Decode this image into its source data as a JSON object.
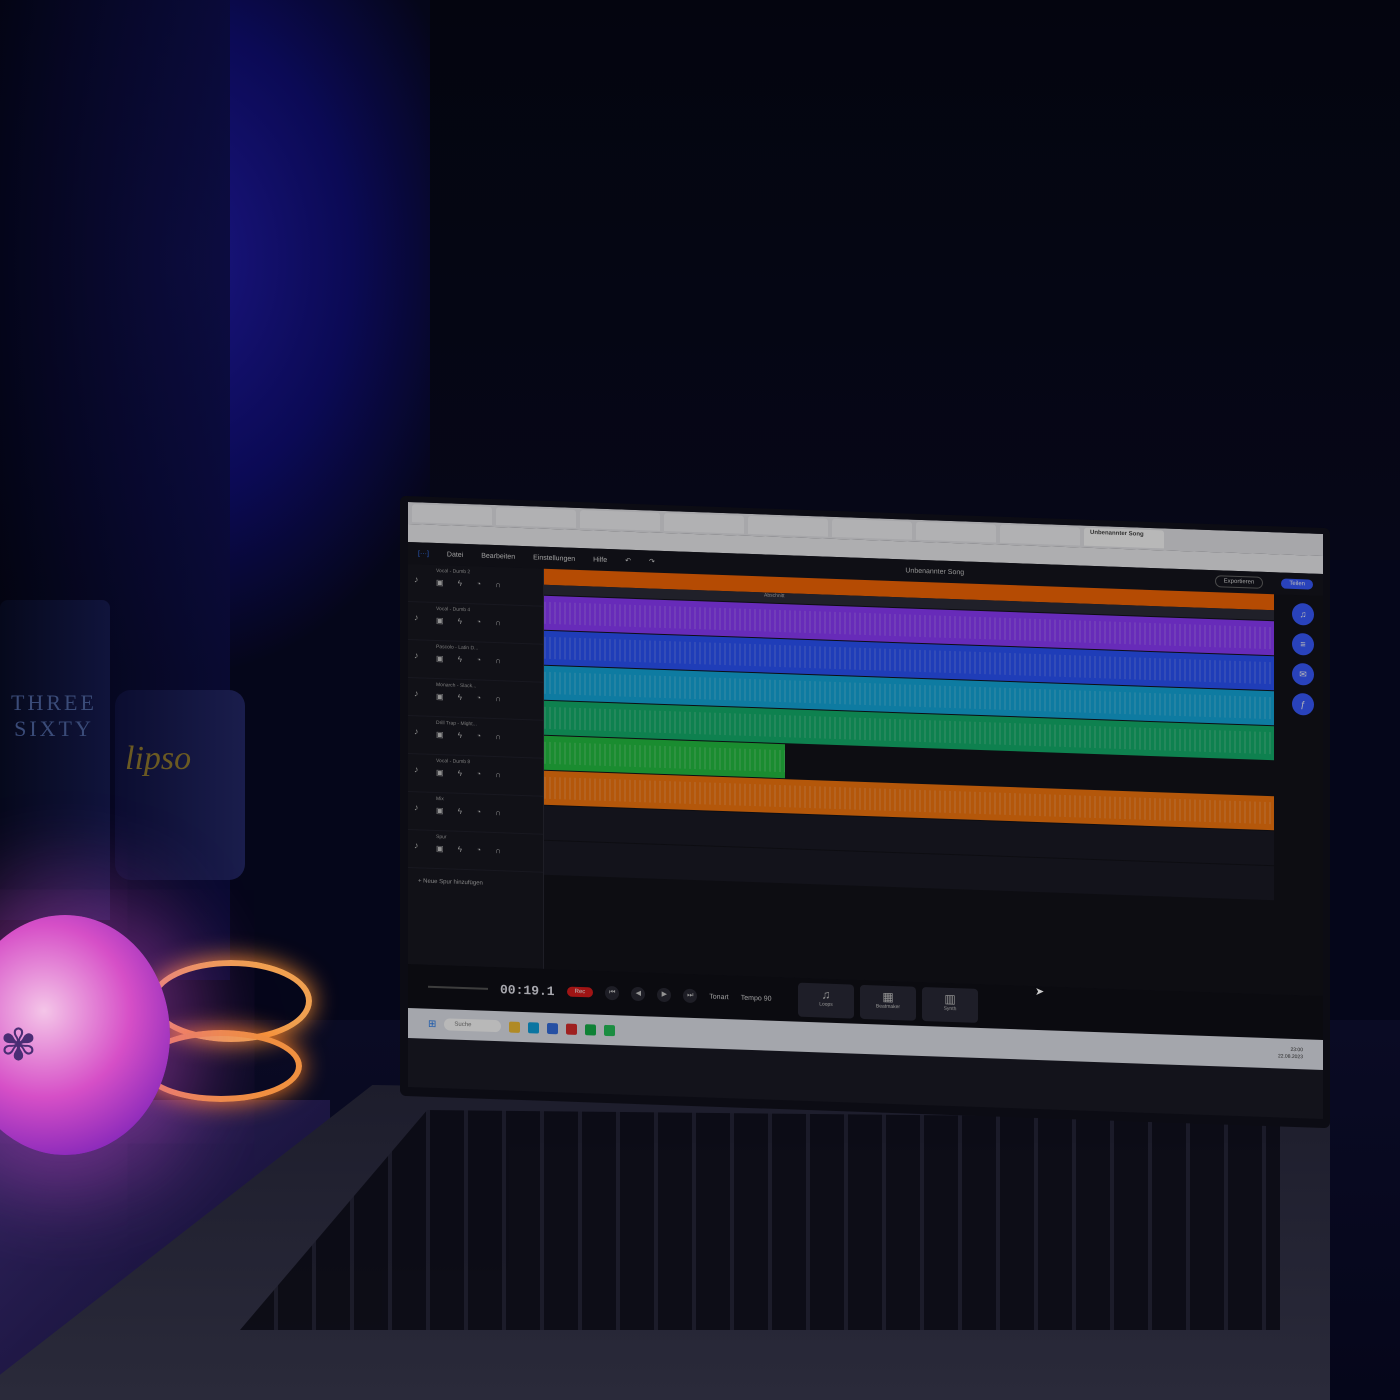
{
  "browser": {
    "tabs": [
      "",
      "",
      "",
      "",
      "",
      "",
      "",
      "",
      "Unbenannter Song"
    ],
    "address": ""
  },
  "menu": {
    "logo": "[···]",
    "items": [
      "Datei",
      "Bearbeiten",
      "Einstellungen",
      "Hilfe"
    ],
    "song_title": "Unbenannter Song",
    "export_label": "Exportieren",
    "share_label": "Teilen"
  },
  "timeline": {
    "section_label": "Abschnitt"
  },
  "tracks": [
    {
      "name": "Vocal - Dumb 2",
      "color": "#8a3ff2",
      "icon": "microphone-icon",
      "clip_end": 1.0
    },
    {
      "name": "Vocal - Dumb 4",
      "color": "#2f55f0",
      "icon": "microphone-icon",
      "clip_end": 1.0
    },
    {
      "name": "Pascolo - Latin D...",
      "color": "#1fa8d8",
      "icon": "microphone-icon",
      "clip_end": 1.0
    },
    {
      "name": "Monarch - Slack...",
      "color": "#1fb070",
      "icon": "microphone-icon",
      "clip_end": 1.0
    },
    {
      "name": "Drill Trap - Might...",
      "color": "#2fbf4a",
      "icon": "drum-icon",
      "clip_end": 0.33
    },
    {
      "name": "Vocal - Dumb 8",
      "color": "#f07a1a",
      "icon": "microphone-icon",
      "clip_end": 1.0
    },
    {
      "name": "Mix",
      "color": "",
      "icon": "pencil-icon",
      "clip_end": 0.0
    },
    {
      "name": "Spur",
      "color": "",
      "icon": "record-icon",
      "clip_end": 0.0
    }
  ],
  "new_track_label": "+ Neue Spur hinzufügen",
  "transport": {
    "time": "00:19.1",
    "rec_label": "Rec",
    "tonart_label": "Tonart",
    "tempo_label": "Tempo 90"
  },
  "modes": [
    {
      "label": "Loops",
      "icon": "music-note-icon",
      "glyph": "♫"
    },
    {
      "label": "Beatmaker",
      "icon": "grid-icon",
      "glyph": "▦"
    },
    {
      "label": "Synth",
      "icon": "keyboard-icon",
      "glyph": "▥"
    }
  ],
  "taskbar": {
    "search_placeholder": "Suche",
    "time": "23:00",
    "date": "22.08.2023"
  },
  "colors": {
    "accent": "#3d5cf5",
    "loop": "#f06a10",
    "record": "#d02020"
  }
}
